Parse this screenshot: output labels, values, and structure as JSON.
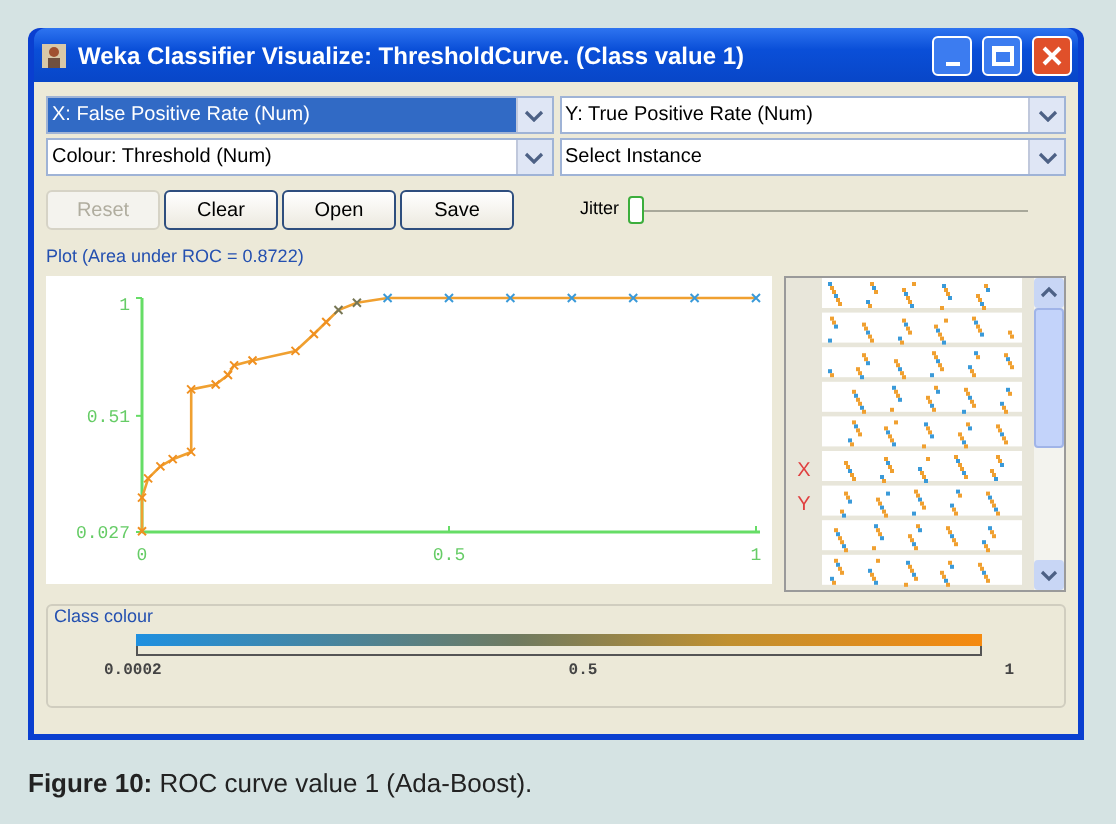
{
  "window": {
    "title": "Weka Classifier Visualize: ThresholdCurve. (Class value 1)"
  },
  "selectors": [
    {
      "value": "X: False Positive Rate (Num)",
      "selected": true
    },
    {
      "value": "Y: True Positive Rate (Num)",
      "selected": false
    },
    {
      "value": "Colour: Threshold (Num)",
      "selected": false
    },
    {
      "value": "Select Instance",
      "selected": false
    }
  ],
  "buttons": [
    {
      "label": "Reset",
      "disabled": true
    },
    {
      "label": "Clear",
      "disabled": false
    },
    {
      "label": "Open",
      "disabled": false
    },
    {
      "label": "Save",
      "disabled": false
    }
  ],
  "jitter": {
    "label": "Jitter",
    "level": 0
  },
  "plot": {
    "title": "Plot (Area under ROC = 0.8722)",
    "chart_data": {
      "type": "line",
      "x": [
        0,
        0,
        0.01,
        0.03,
        0.05,
        0.08,
        0.08,
        0.12,
        0.14,
        0.15,
        0.18,
        0.25,
        0.28,
        0.3,
        0.32,
        0.35,
        0.4,
        0.5,
        0.6,
        0.7,
        0.8,
        0.9,
        1
      ],
      "series": [
        {
          "color": "#f0a030",
          "marker": "x",
          "values": [
            0.03,
            0.17,
            0.25,
            0.3,
            0.33,
            0.36,
            0.62,
            0.64,
            0.68,
            0.72,
            0.74,
            0.78,
            0.85,
            0.9,
            0.95,
            0.98,
            1,
            1,
            1,
            1,
            1,
            1,
            1
          ]
        }
      ],
      "xlim": [
        0,
        1
      ],
      "ylim": [
        0.027,
        1
      ],
      "xticks": [
        0,
        0.5,
        1
      ],
      "yticks": [
        {
          "value": 0.027,
          "label": "0.027"
        },
        {
          "value": 0.51,
          "label": "0.51"
        },
        {
          "value": 1,
          "label": "1"
        }
      ]
    }
  },
  "attribute_panel": {
    "x_marker": "X",
    "y_marker": "Y"
  },
  "class_colour": {
    "title": "Class colour",
    "ticks": [
      "0.0002",
      "0.5",
      "1"
    ]
  },
  "caption": {
    "label": "Figure 10:",
    "text": "ROC curve value 1 (Ada-Boost)."
  }
}
